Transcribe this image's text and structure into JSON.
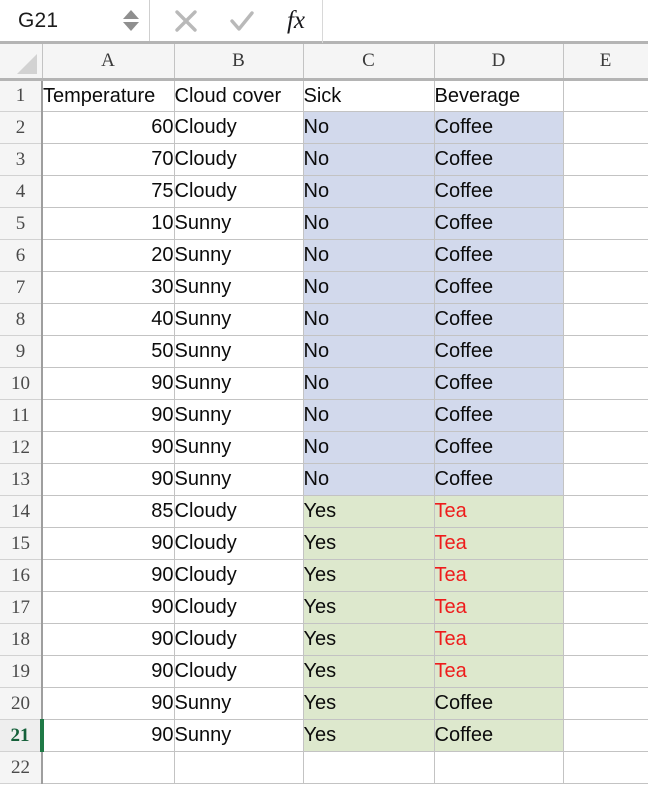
{
  "formula_bar": {
    "name_box_value": "G21",
    "formula_value": "",
    "cancel_icon": "close-x-icon",
    "confirm_icon": "checkmark-icon",
    "function_icon": "fx",
    "spinner_up_icon": "spinner-up-icon",
    "spinner_down_icon": "spinner-down-icon"
  },
  "grid": {
    "column_headers": [
      "A",
      "B",
      "C",
      "D",
      "E"
    ],
    "row_headers": [
      "1",
      "2",
      "3",
      "4",
      "5",
      "6",
      "7",
      "8",
      "9",
      "10",
      "11",
      "12",
      "13",
      "14",
      "15",
      "16",
      "17",
      "18",
      "19",
      "20",
      "21",
      "22"
    ],
    "active_row": "21",
    "active_cell": "G21",
    "colors": {
      "highlight_blue": "#d2d9ec",
      "highlight_green": "#dde8cd",
      "tea_text_red": "#ee1c1c",
      "active_row_green": "#1f7a46",
      "header_background": "#f5f5f5",
      "gridline": "#c3c3c3"
    },
    "header_row": {
      "A": "Temperature",
      "B": "Cloud cover",
      "C": "Sick",
      "D": "Beverage",
      "E": ""
    },
    "rows": [
      {
        "row": "2",
        "A": "60",
        "B": "Cloudy",
        "C": "No",
        "D": "Coffee",
        "E": "",
        "fill": "blue",
        "d_red": false
      },
      {
        "row": "3",
        "A": "70",
        "B": "Cloudy",
        "C": "No",
        "D": "Coffee",
        "E": "",
        "fill": "blue",
        "d_red": false
      },
      {
        "row": "4",
        "A": "75",
        "B": "Cloudy",
        "C": "No",
        "D": "Coffee",
        "E": "",
        "fill": "blue",
        "d_red": false
      },
      {
        "row": "5",
        "A": "10",
        "B": "Sunny",
        "C": "No",
        "D": "Coffee",
        "E": "",
        "fill": "blue",
        "d_red": false
      },
      {
        "row": "6",
        "A": "20",
        "B": "Sunny",
        "C": "No",
        "D": "Coffee",
        "E": "",
        "fill": "blue",
        "d_red": false
      },
      {
        "row": "7",
        "A": "30",
        "B": "Sunny",
        "C": "No",
        "D": "Coffee",
        "E": "",
        "fill": "blue",
        "d_red": false
      },
      {
        "row": "8",
        "A": "40",
        "B": "Sunny",
        "C": "No",
        "D": "Coffee",
        "E": "",
        "fill": "blue",
        "d_red": false
      },
      {
        "row": "9",
        "A": "50",
        "B": "Sunny",
        "C": "No",
        "D": "Coffee",
        "E": "",
        "fill": "blue",
        "d_red": false
      },
      {
        "row": "10",
        "A": "90",
        "B": "Sunny",
        "C": "No",
        "D": "Coffee",
        "E": "",
        "fill": "blue",
        "d_red": false
      },
      {
        "row": "11",
        "A": "90",
        "B": "Sunny",
        "C": "No",
        "D": "Coffee",
        "E": "",
        "fill": "blue",
        "d_red": false
      },
      {
        "row": "12",
        "A": "90",
        "B": "Sunny",
        "C": "No",
        "D": "Coffee",
        "E": "",
        "fill": "blue",
        "d_red": false
      },
      {
        "row": "13",
        "A": "90",
        "B": "Sunny",
        "C": "No",
        "D": "Coffee",
        "E": "",
        "fill": "blue",
        "d_red": false
      },
      {
        "row": "14",
        "A": "85",
        "B": "Cloudy",
        "C": "Yes",
        "D": "Tea",
        "E": "",
        "fill": "green",
        "d_red": true
      },
      {
        "row": "15",
        "A": "90",
        "B": "Cloudy",
        "C": "Yes",
        "D": "Tea",
        "E": "",
        "fill": "green",
        "d_red": true
      },
      {
        "row": "16",
        "A": "90",
        "B": "Cloudy",
        "C": "Yes",
        "D": "Tea",
        "E": "",
        "fill": "green",
        "d_red": true
      },
      {
        "row": "17",
        "A": "90",
        "B": "Cloudy",
        "C": "Yes",
        "D": "Tea",
        "E": "",
        "fill": "green",
        "d_red": true
      },
      {
        "row": "18",
        "A": "90",
        "B": "Cloudy",
        "C": "Yes",
        "D": "Tea",
        "E": "",
        "fill": "green",
        "d_red": true
      },
      {
        "row": "19",
        "A": "90",
        "B": "Cloudy",
        "C": "Yes",
        "D": "Tea",
        "E": "",
        "fill": "green",
        "d_red": true
      },
      {
        "row": "20",
        "A": "90",
        "B": "Sunny",
        "C": "Yes",
        "D": "Coffee",
        "E": "",
        "fill": "green",
        "d_red": false
      },
      {
        "row": "21",
        "A": "90",
        "B": "Sunny",
        "C": "Yes",
        "D": "Coffee",
        "E": "",
        "fill": "green",
        "d_red": false
      },
      {
        "row": "22",
        "A": "",
        "B": "",
        "C": "",
        "D": "",
        "E": "",
        "fill": "none",
        "d_red": false
      }
    ]
  }
}
